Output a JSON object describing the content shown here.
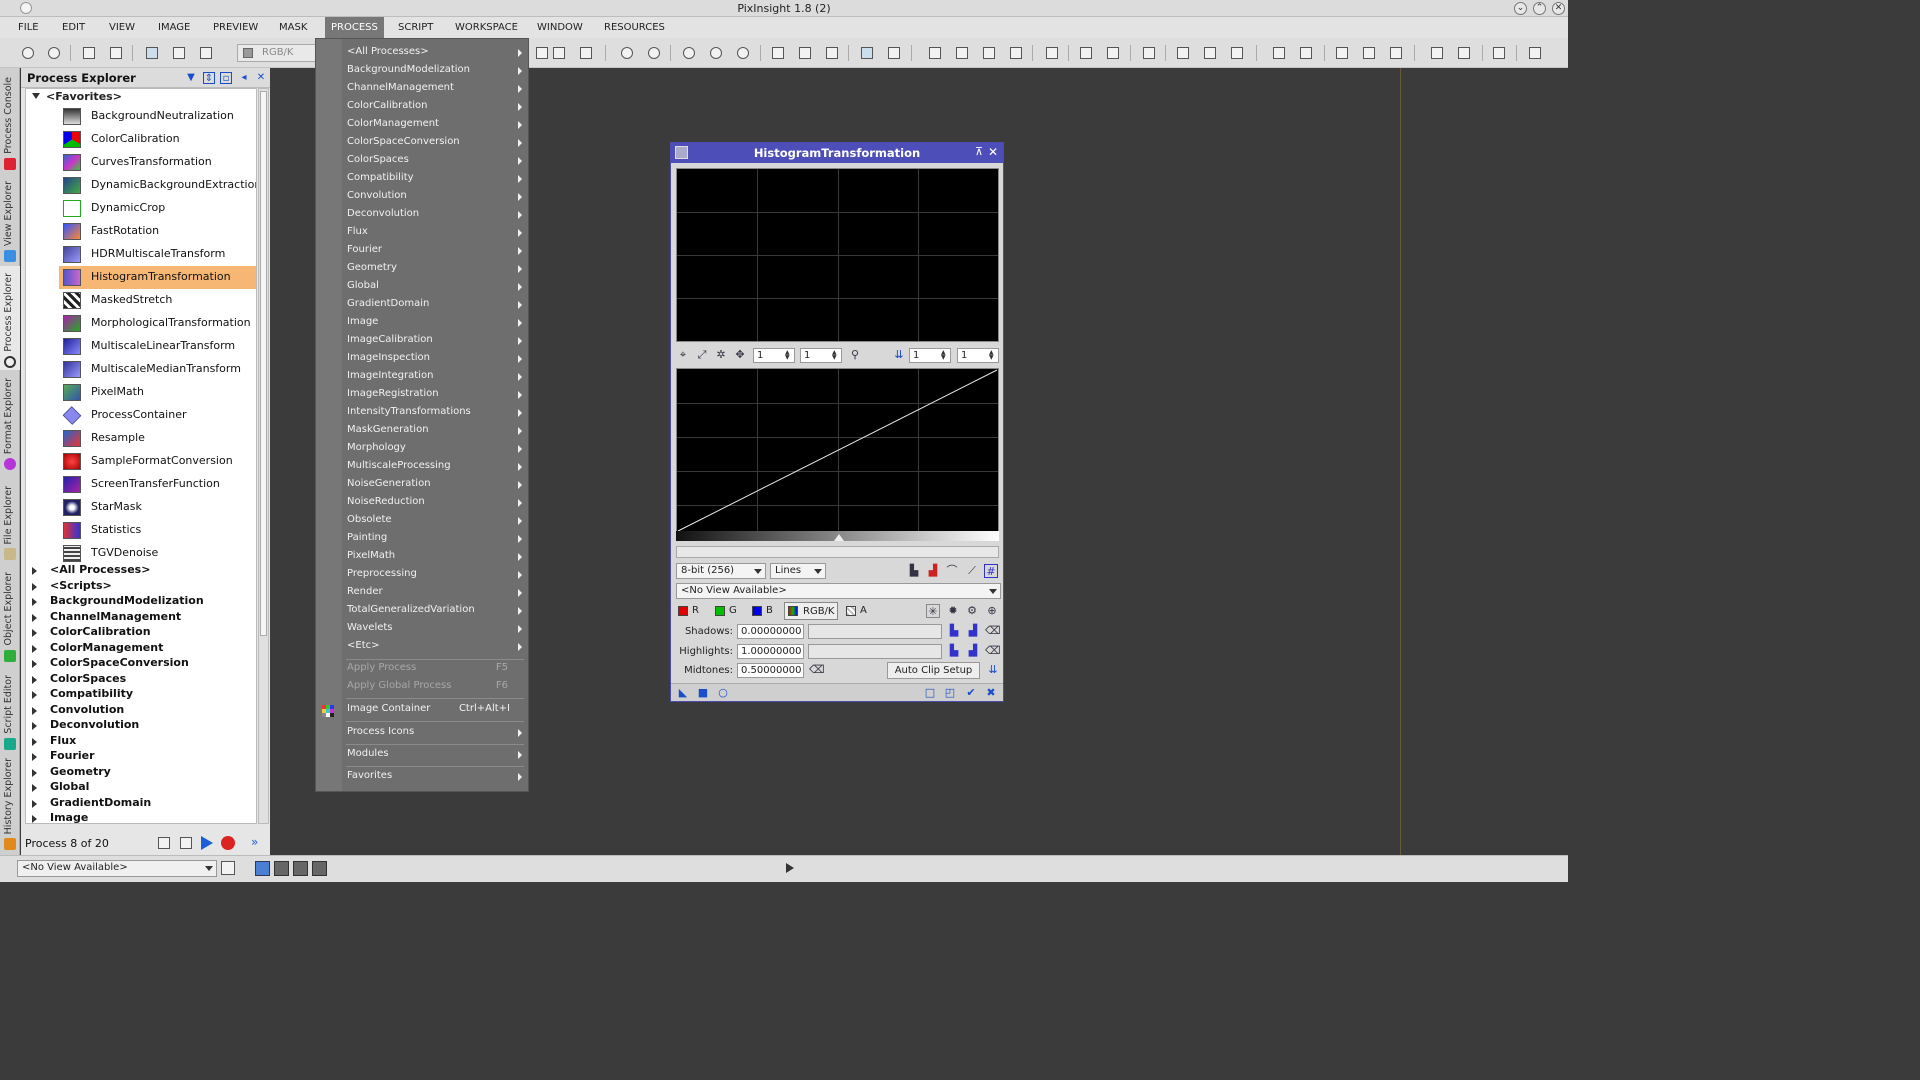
{
  "window": {
    "title": "PixInsight 1.8 (2)"
  },
  "menubar": {
    "items": [
      "FILE",
      "EDIT",
      "VIEW",
      "IMAGE",
      "PREVIEW",
      "MASK",
      "PROCESS",
      "SCRIPT",
      "WORKSPACE",
      "WINDOW",
      "RESOURCES"
    ],
    "active": "PROCESS"
  },
  "toolbar": {
    "channel_combo": "RGB/K"
  },
  "side_tabs": [
    "Process Console",
    "View Explorer",
    "Process Explorer",
    "Format Explorer",
    "File Explorer",
    "Object Explorer",
    "Script Editor",
    "History Explorer"
  ],
  "process_explorer": {
    "title": "Process Explorer",
    "favorites_label": "<Favorites>",
    "favorites": [
      "BackgroundNeutralization",
      "ColorCalibration",
      "CurvesTransformation",
      "DynamicBackgroundExtraction",
      "DynamicCrop",
      "FastRotation",
      "HDRMultiscaleTransform",
      "HistogramTransformation",
      "MaskedStretch",
      "MorphologicalTransformation",
      "MultiscaleLinearTransform",
      "MultiscaleMedianTransform",
      "PixelMath",
      "ProcessContainer",
      "Resample",
      "SampleFormatConversion",
      "ScreenTransferFunction",
      "StarMask",
      "Statistics",
      "TGVDenoise"
    ],
    "selected": "HistogramTransformation",
    "categories": [
      "<All Processes>",
      "<Scripts>",
      "BackgroundModelization",
      "ChannelManagement",
      "ColorCalibration",
      "ColorManagement",
      "ColorSpaceConversion",
      "ColorSpaces",
      "Compatibility",
      "Convolution",
      "Deconvolution",
      "Flux",
      "Fourier",
      "Geometry",
      "Global",
      "GradientDomain",
      "Image"
    ],
    "footer": "Process 8 of 20"
  },
  "process_menu": {
    "submenus": [
      "<All Processes>",
      "BackgroundModelization",
      "ChannelManagement",
      "ColorCalibration",
      "ColorManagement",
      "ColorSpaceConversion",
      "ColorSpaces",
      "Compatibility",
      "Convolution",
      "Deconvolution",
      "Flux",
      "Fourier",
      "Geometry",
      "Global",
      "GradientDomain",
      "Image",
      "ImageCalibration",
      "ImageInspection",
      "ImageIntegration",
      "ImageRegistration",
      "IntensityTransformations",
      "MaskGeneration",
      "Morphology",
      "MultiscaleProcessing",
      "NoiseGeneration",
      "NoiseReduction",
      "Obsolete",
      "Painting",
      "PixelMath",
      "Preprocessing",
      "Render",
      "TotalGeneralizedVariation",
      "Wavelets",
      "<Etc>"
    ],
    "apply_process": "Apply Process",
    "apply_process_shortcut": "F5",
    "apply_global": "Apply Global Process",
    "apply_global_shortcut": "F6",
    "image_container": "Image Container",
    "image_container_shortcut": "Ctrl+Alt+I",
    "process_icons": "Process Icons",
    "modules": "Modules",
    "favorites": "Favorites"
  },
  "histogram": {
    "title": "HistogramTransformation",
    "zoom_h1": "1",
    "zoom_v1": "1",
    "zoom_h2": "1",
    "zoom_v2": "1",
    "resolution": "8-bit (256)",
    "graph_style": "Lines",
    "view": "<No View Available>",
    "channels": [
      "R",
      "G",
      "B",
      "RGB/K",
      "A"
    ],
    "channel_colors": [
      "#e00000",
      "#00c000",
      "#0000e0",
      "#444444",
      "#ffffff"
    ],
    "shadows_label": "Shadows:",
    "shadows": "0.00000000",
    "highlights_label": "Highlights:",
    "highlights": "1.00000000",
    "midtones_label": "Midtones:",
    "midtones": "0.50000000",
    "auto_clip": "Auto Clip Setup"
  },
  "statusbar": {
    "view_combo": "<No View Available>"
  }
}
